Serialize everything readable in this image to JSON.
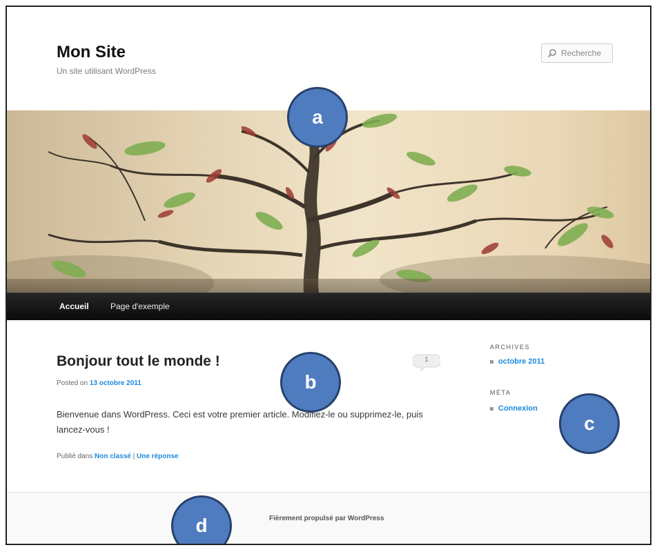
{
  "header": {
    "site_title": "Mon Site",
    "site_description": "Un site utilisant WordPress",
    "search_placeholder": "Recherche"
  },
  "nav": {
    "items": [
      {
        "label": "Accueil",
        "active": true
      },
      {
        "label": "Page d'exemple",
        "active": false
      }
    ]
  },
  "post": {
    "title": "Bonjour tout le monde !",
    "comment_count": "1",
    "meta_prefix": "Posted on",
    "date": "13 octobre 2011",
    "body": "Bienvenue dans WordPress. Ceci est votre premier article. Modifiez-le ou supprimez-le, puis lancez-vous !",
    "footer_prefix": "Publié dans",
    "category": "Non classé",
    "separator": "|",
    "reply": "Une réponse"
  },
  "sidebar": {
    "archives_title": "ARCHIVES",
    "archives_items": [
      "octobre 2011"
    ],
    "meta_title": "MÉTA",
    "meta_items": [
      "Connexion"
    ]
  },
  "footer": {
    "text": "Fièrement propulsé par WordPress"
  },
  "callouts": {
    "a": "a",
    "b": "b",
    "c": "c",
    "d": "d"
  },
  "colors": {
    "accent": "#1b8be0",
    "callout": "#4f7bbf",
    "nav_bg": "#111111"
  }
}
